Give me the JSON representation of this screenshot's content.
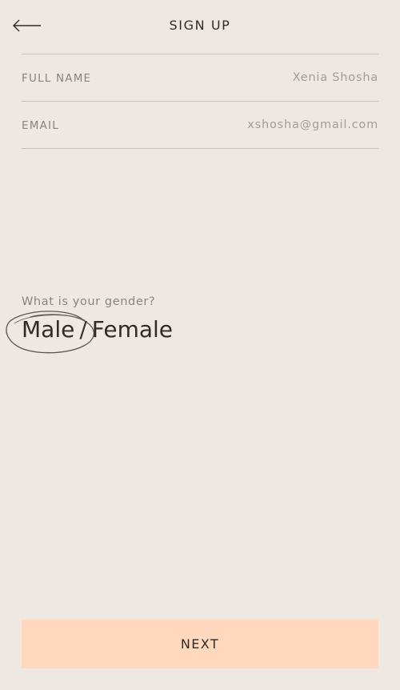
{
  "header": {
    "title": "SIGN UP",
    "back_icon": "arrow-left-icon"
  },
  "form": {
    "full_name": {
      "label": "FULL NAME",
      "value": "Xenia Shosha"
    },
    "email": {
      "label": "EMAIL",
      "value": "xshosha@gmail.com"
    }
  },
  "gender": {
    "question": "What is your gender?",
    "options": [
      "Male",
      "Female"
    ],
    "separator": "/",
    "selected": "Male"
  },
  "footer": {
    "next_label": "NEXT"
  },
  "colors": {
    "background": "#efe8e2",
    "button": "#ffd8bd",
    "text": "#2f2b28",
    "muted": "#8a8480"
  }
}
